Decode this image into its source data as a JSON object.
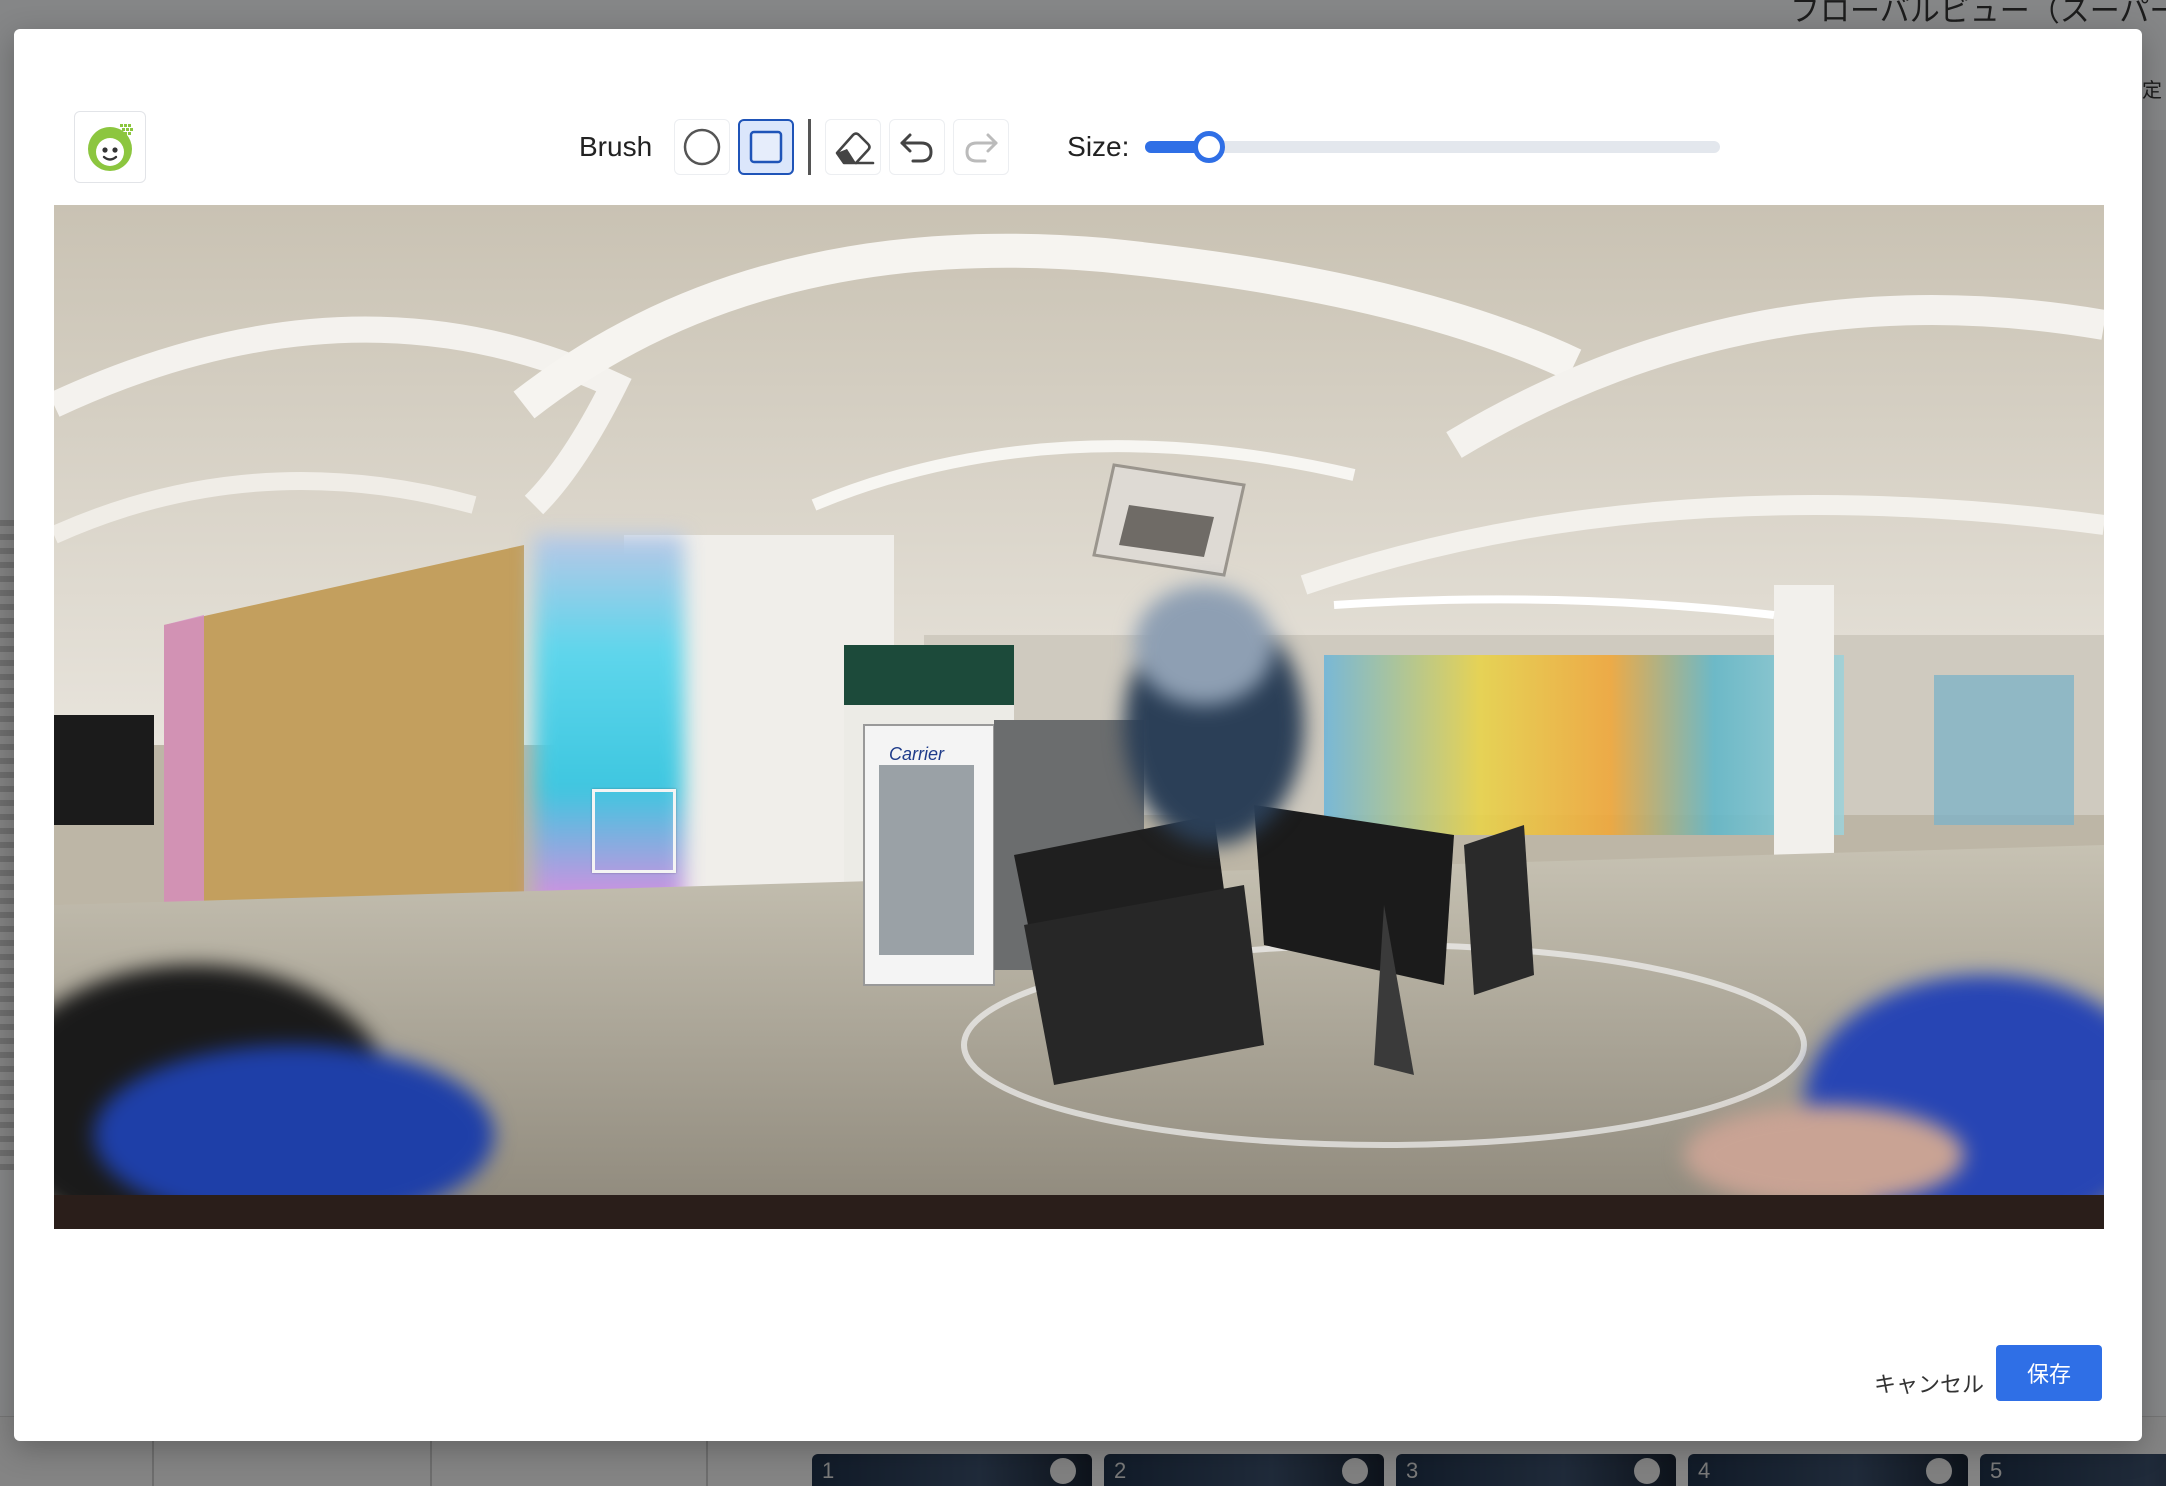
{
  "background": {
    "header_fragment": "フローバルビュー（スーパーツ",
    "right_fragment": "定",
    "thumbnails": [
      {
        "number": "1"
      },
      {
        "number": "2"
      },
      {
        "number": "3"
      },
      {
        "number": "4"
      },
      {
        "number": "5"
      }
    ]
  },
  "modal": {
    "logo_icon": "face-logo-icon",
    "toolbar": {
      "brush_label": "Brush",
      "tools": [
        {
          "name": "circle-brush",
          "icon": "circle-icon",
          "active": false
        },
        {
          "name": "square-brush",
          "icon": "square-icon",
          "active": true
        },
        {
          "name": "eraser",
          "icon": "eraser-icon",
          "active": false
        },
        {
          "name": "undo",
          "icon": "undo-icon",
          "active": false
        },
        {
          "name": "redo",
          "icon": "redo-icon",
          "active": false,
          "disabled": true
        }
      ],
      "size_label": "Size:",
      "size_value": 0.11
    },
    "canvas": {
      "description_icon": "panorama-image"
    },
    "footer": {
      "cancel_label": "キャンセル",
      "save_label": "保存"
    }
  },
  "colors": {
    "accent": "#2f6fe6",
    "active_tool_border": "#1f54b8",
    "active_tool_bg": "#dbe6fb"
  }
}
